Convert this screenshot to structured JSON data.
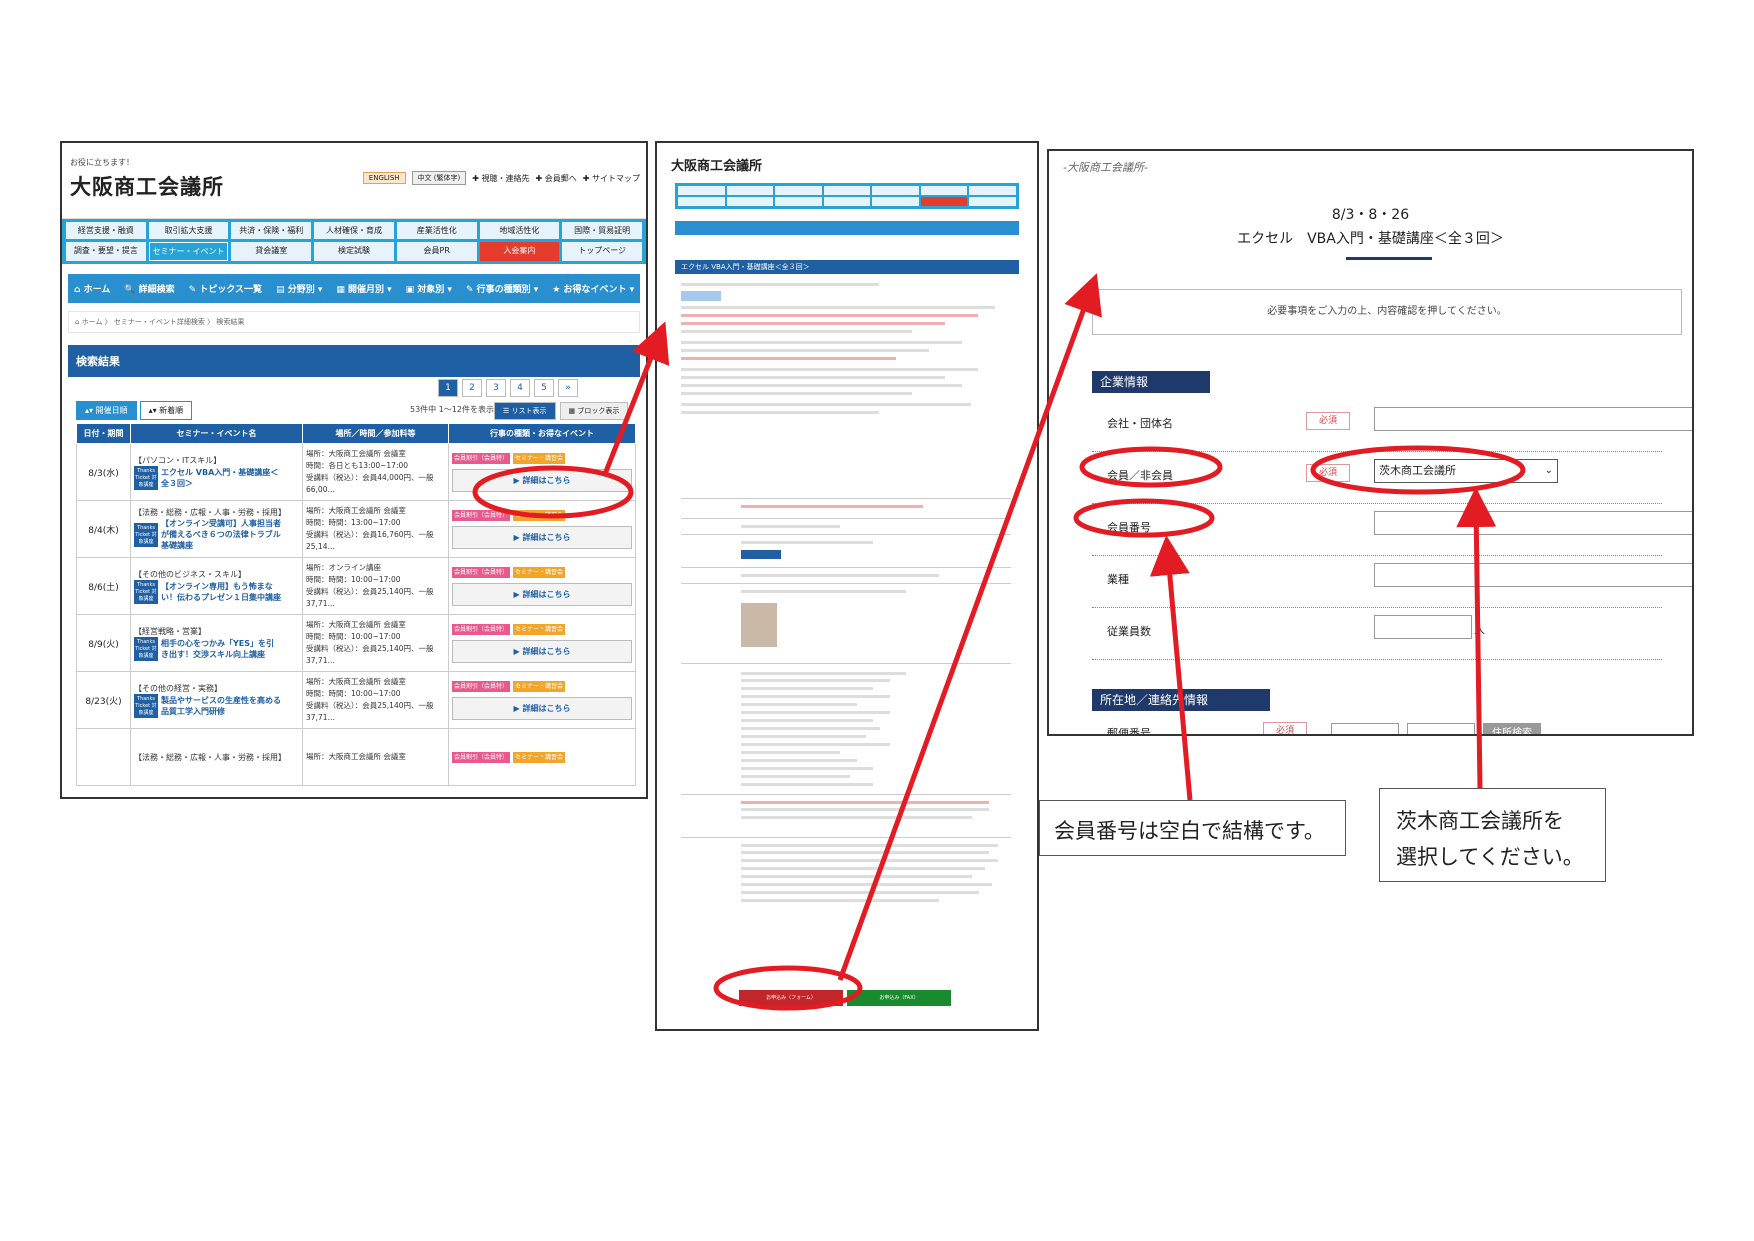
{
  "panel1": {
    "tagline": "お役に立ちます！",
    "logo": "大阪商工会議所",
    "lang_en": "ENGLISH",
    "lang_cn": "中文 (繁体字)",
    "top_links": [
      "✚ 視聴・連絡先",
      "✚ 会員郵へ",
      "✚ サイトマップ"
    ],
    "menu": [
      "経営支援・融資",
      "取引拡大支援",
      "共済・保険・福利",
      "人材確保・育成",
      "産業活性化",
      "地域活性化",
      "国際・貿易証明",
      "調査・要望・提言",
      "セミナー・イベント",
      "貸会議室",
      "検定試験",
      "会員PR",
      "入会案内",
      "トップページ"
    ],
    "nav": [
      "⌂ ホーム",
      "🔍 詳細検索",
      "✎ トピックス一覧",
      "▤ 分野別 ▾",
      "▦ 開催月別 ▾",
      "▣ 対象別 ▾",
      "✎ 行事の種類別 ▾",
      "★ お得なイベント ▾"
    ],
    "breadcrumb": "⌂ ホーム 〉 セミナー・イベント詳細検索 〉 検索結果",
    "result_title": "検索結果",
    "pages": [
      "1",
      "2",
      "3",
      "4",
      "5",
      "»"
    ],
    "tab_date": "▴▾ 開催日順",
    "tab_new": "▴▾ 新着順",
    "count": "53件中 1～12件を表示",
    "view_list": "☰ リスト表示",
    "view_block": "▦ ブロック表示",
    "headers": [
      "日付・期間",
      "セミナー・イベント名",
      "場所／時間／参加料等",
      "行事の種類・お得なイベント"
    ],
    "rows": [
      {
        "date": "8/3(水)",
        "cat": "【パソコン・ITスキル】",
        "name": "エクセル VBA入門・基礎講座＜全３回＞",
        "place": "場所：大阪商工会議所 会議室",
        "time": "時間：各日とも13:00~17:00",
        "fee": "受講料（税込）：会員44,000円、一般66,00…"
      },
      {
        "date": "8/4(木)",
        "cat": "【法務・総務・広報・人事・労務・採用】",
        "name": "【オンライン受講可】人事担当者が備えるべき６つの法律トラブル基礎講座",
        "place": "場所：大阪商工会議所 会議室",
        "time": "時間：時間：13:00~17:00",
        "fee": "受講料（税込）：会員16,760円、一般25,14…"
      },
      {
        "date": "8/6(土)",
        "cat": "【その他のビジネス・スキル】",
        "name": "【オンライン専用】もう怖まない！伝わるプレゼン１日集中講座",
        "place": "場所：オンライン講座",
        "time": "時間：時間：10:00~17:00",
        "fee": "受講料（税込）：会員25,140円、一般37,71…"
      },
      {
        "date": "8/9(火)",
        "cat": "【経営戦略・営業】",
        "name": "相手の心をつかみ「YES」を引き出す！交渉スキル向上講座",
        "place": "場所：大阪商工会議所 会議室",
        "time": "時間：時間：10:00~17:00",
        "fee": "受講料（税込）：会員25,140円、一般37,71…"
      },
      {
        "date": "8/23(火)",
        "cat": "【その他の経営・実務】",
        "name": "製品やサービスの生産性を高める品質工学入門研修",
        "place": "場所：大阪商工会議所 会議室",
        "time": "時間：時間：10:00~17:00",
        "fee": "受講料（税込）：会員25,140円、一般37,71…"
      }
    ],
    "last_row_cat": "【法務・総務・広報・人事・労務・採用】",
    "last_row_place": "場所：大阪商工会議所 会議室",
    "ticket": "Thanks Ticket 対象講座",
    "badge_member": "会員割引（会員特）",
    "badge_seminar": "セミナー・講習会",
    "detail_btn": "▶ 詳細はこちら"
  },
  "panel2": {
    "logo": "大阪商工会議所",
    "title": "エクセル VBA入門・基礎講座＜全３回＞",
    "apply_btn": "お申込み（フォーム）",
    "apply_btn2": "お申込み（FAX）",
    "highlight_color": "#e31b23"
  },
  "panel3": {
    "header": "-大阪商工会議所-",
    "title_dates": "8/3・8・26",
    "title_course": "エクセル　VBA入門・基礎講座＜全３回＞",
    "notice": "必要事項をご入力の上、内容確認を押してください。",
    "section_company": "企業情報",
    "section_address": "所在地／連絡先情報",
    "required": "必須",
    "fields": {
      "company": "会社・団体名",
      "member": "会員／非会員",
      "member_no": "会員番号",
      "industry": "業種",
      "employees": "従業員数",
      "postal": "郵便番号"
    },
    "member_select_value": "茨木商工会議所",
    "employees_unit": "人",
    "postal_btn": "住所検索"
  },
  "callouts": {
    "member_no_note": "会員番号は空白で結構です。",
    "select_note_line1": "茨木商工会議所を",
    "select_note_line2": "選択してください。"
  }
}
